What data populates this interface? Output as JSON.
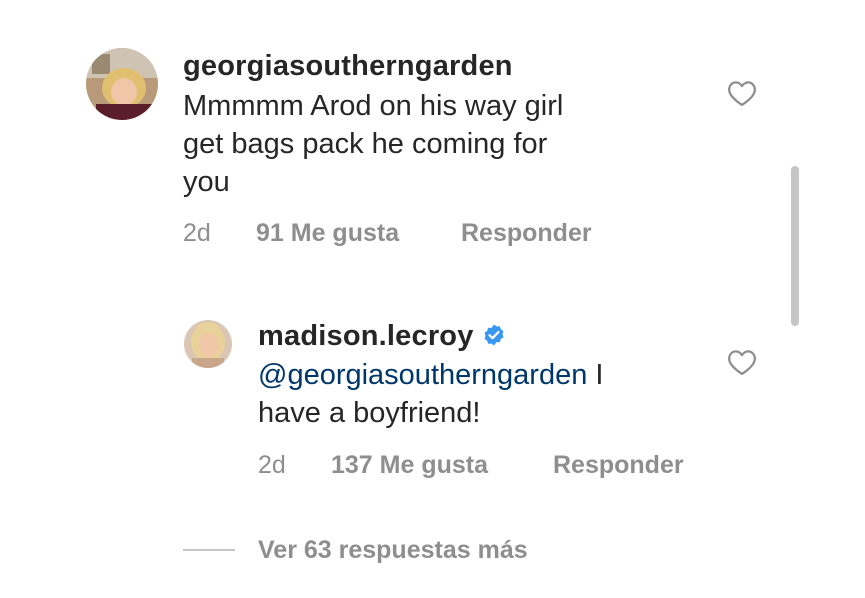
{
  "comments": [
    {
      "username": "georgiasoutherngarden",
      "text_lines": [
        "Mmmmm Arod on his way girl",
        "get bags pack he coming for",
        "you"
      ],
      "time": "2d",
      "likes": "91 Me gusta",
      "reply_label": "Responder"
    }
  ],
  "reply": {
    "username": "madison.lecroy",
    "verified": true,
    "mention": "@georgiasoutherngarden",
    "text_after_mention": " I",
    "text_line2": "have a boyfriend!",
    "time": "2d",
    "likes": "137 Me gusta",
    "reply_label": "Responder"
  },
  "view_more": "Ver 63 respuestas más",
  "colors": {
    "primary_text": "#262626",
    "secondary_text": "#8e8e8e",
    "mention": "#00376b",
    "verified_badge": "#3897f0"
  },
  "icons": {
    "like": "heart-outline-icon",
    "verified": "verified-badge-icon"
  }
}
